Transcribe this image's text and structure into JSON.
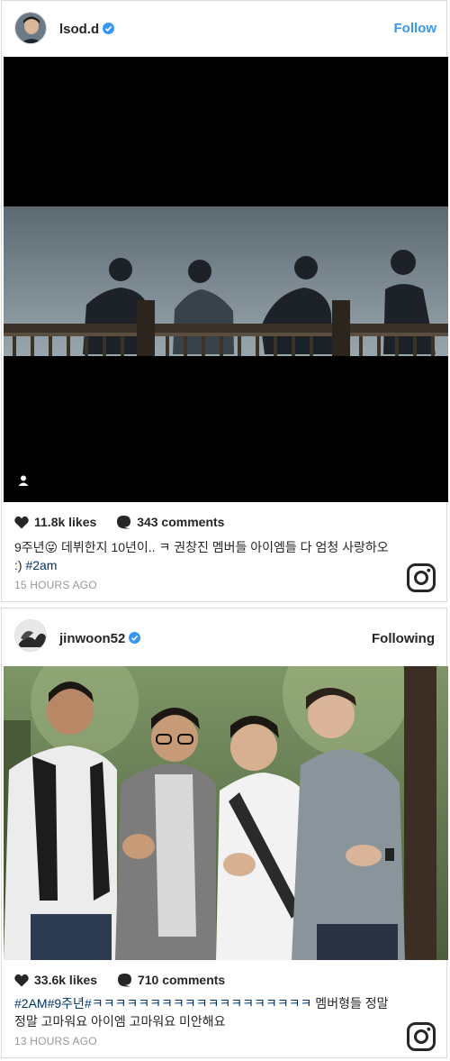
{
  "posts": [
    {
      "username": "lsod.d",
      "follow_label": "Follow",
      "likes": "11.8k likes",
      "comments": "343 comments",
      "caption_text": "9주년😜 데뷔한지 10년이.. ㅋ 권창진 멤버들 아이엠들 다 엄청 사랑하오 :) ",
      "caption_tag": "#2am",
      "time": "15 HOURS AGO"
    },
    {
      "username": "jinwoon52",
      "follow_label": "Following",
      "likes": "33.6k likes",
      "comments": "710 comments",
      "caption_tag": "#2AM#9주년#ㅋㅋㅋㅋㅋㅋㅋㅋㅋㅋㅋㅋㅋㅋㅋㅋㅋㅋㅋ",
      "caption_text": " 멤버형들 정말정말 고마워요 아이엠 고마워요 미안해요",
      "time": "13 HOURS AGO"
    }
  ],
  "icons": {
    "verified": "verified-badge-icon",
    "heart": "heart-icon",
    "comment": "comment-bubble-icon",
    "instagram": "instagram-logo-icon",
    "user": "user-tag-icon"
  },
  "colors": {
    "link_blue": "#3897f0",
    "hashtag": "#003569",
    "timestamp": "#999999",
    "border": "#dbdbdb"
  }
}
